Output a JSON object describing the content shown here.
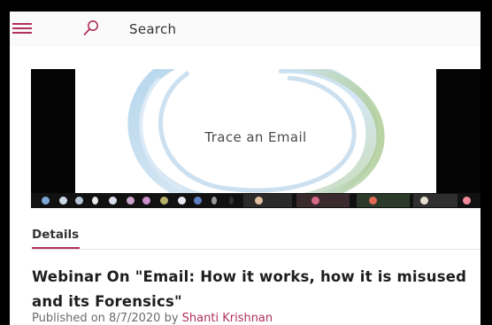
{
  "topbar": {
    "menu_icon": "hamburger-icon",
    "search_icon": "search-icon",
    "search_label": "Search",
    "accent_color": "#b0305f"
  },
  "video": {
    "slide_title": "Trace an Email"
  },
  "tabs": [
    {
      "label": "Details",
      "active": true
    }
  ],
  "content": {
    "title": "Webinar On \"Email: How it works, how it is misused and its Forensics\"",
    "published_prefix": "Published on 8/7/2020 by ",
    "author": "Shanti Krishnan"
  }
}
